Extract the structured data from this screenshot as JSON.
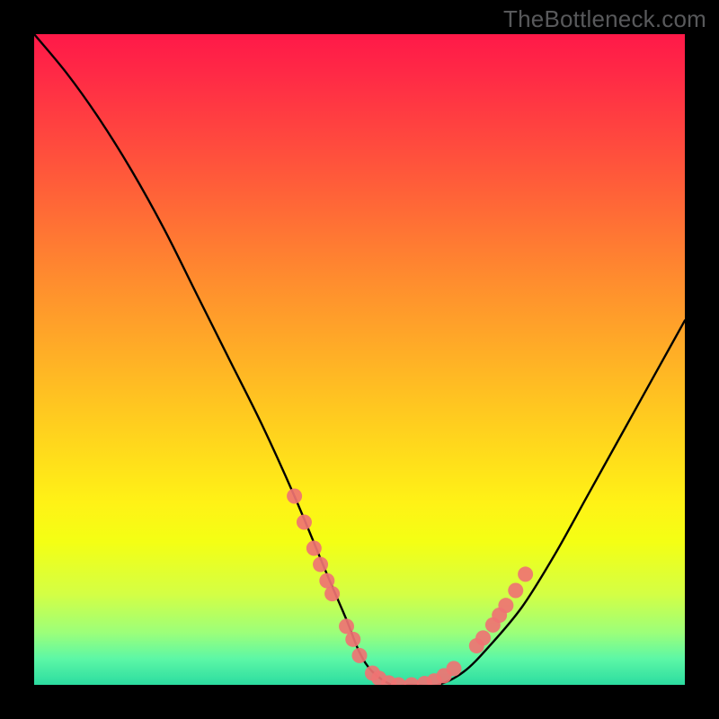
{
  "watermark": "TheBottleneck.com",
  "chart_data": {
    "type": "line",
    "title": "",
    "xlabel": "",
    "ylabel": "",
    "xlim": [
      0,
      100
    ],
    "ylim": [
      0,
      100
    ],
    "series": [
      {
        "name": "curve",
        "x": [
          0,
          5,
          10,
          15,
          20,
          25,
          30,
          35,
          40,
          45,
          48,
          50,
          52,
          55,
          58,
          62,
          66,
          70,
          75,
          80,
          85,
          90,
          95,
          100
        ],
        "y": [
          100,
          94,
          87,
          79,
          70,
          60,
          50,
          40,
          29,
          17,
          10,
          5,
          2,
          0,
          0,
          0,
          2,
          6,
          12,
          20,
          29,
          38,
          47,
          56
        ]
      }
    ],
    "markers": {
      "name": "highlight-dots",
      "color": "#ef7373",
      "points": [
        {
          "x": 40.0,
          "y": 29
        },
        {
          "x": 41.5,
          "y": 25
        },
        {
          "x": 43.0,
          "y": 21
        },
        {
          "x": 44.0,
          "y": 18.5
        },
        {
          "x": 45.0,
          "y": 16
        },
        {
          "x": 45.8,
          "y": 14
        },
        {
          "x": 48.0,
          "y": 9
        },
        {
          "x": 49.0,
          "y": 7
        },
        {
          "x": 50.0,
          "y": 4.5
        },
        {
          "x": 52.0,
          "y": 1.8
        },
        {
          "x": 53.0,
          "y": 1.0
        },
        {
          "x": 54.5,
          "y": 0.3
        },
        {
          "x": 56.0,
          "y": 0.0
        },
        {
          "x": 58.0,
          "y": 0.0
        },
        {
          "x": 60.0,
          "y": 0.2
        },
        {
          "x": 61.5,
          "y": 0.6
        },
        {
          "x": 63.0,
          "y": 1.4
        },
        {
          "x": 64.5,
          "y": 2.5
        },
        {
          "x": 68.0,
          "y": 6.0
        },
        {
          "x": 69.0,
          "y": 7.2
        },
        {
          "x": 70.5,
          "y": 9.2
        },
        {
          "x": 71.5,
          "y": 10.7
        },
        {
          "x": 72.5,
          "y": 12.2
        },
        {
          "x": 74.0,
          "y": 14.5
        },
        {
          "x": 75.5,
          "y": 17.0
        }
      ]
    },
    "gradient_description": "vertical gradient from red (top) through orange and yellow to green (bottom)"
  }
}
